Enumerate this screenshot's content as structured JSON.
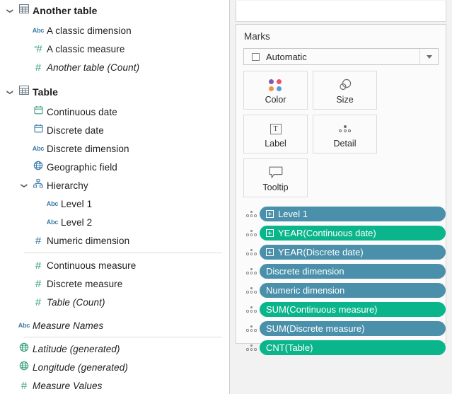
{
  "data_pane": {
    "groups": [
      {
        "name": "Another table",
        "icon": "table-icon",
        "expanded": true,
        "fields": [
          {
            "label": "A classic dimension",
            "icon": "abc-icon",
            "type": "dimension",
            "italic": false,
            "indent": 1
          },
          {
            "label": "A classic measure",
            "icon": "calculated-number-icon",
            "type": "measure",
            "italic": false,
            "indent": 1
          },
          {
            "label": "Another table (Count)",
            "icon": "number-icon",
            "type": "measure",
            "italic": true,
            "indent": 1
          }
        ]
      },
      {
        "name": "Table",
        "icon": "table-icon",
        "expanded": true,
        "fields": [
          {
            "label": "Continuous date",
            "icon": "calendar-green-icon",
            "type": "dimension",
            "italic": false,
            "indent": 1
          },
          {
            "label": "Discrete date",
            "icon": "calendar-blue-icon",
            "type": "dimension",
            "italic": false,
            "indent": 1
          },
          {
            "label": "Discrete dimension",
            "icon": "abc-icon",
            "type": "dimension",
            "italic": false,
            "indent": 1
          },
          {
            "label": "Geographic field",
            "icon": "globe-blue-icon",
            "type": "dimension",
            "italic": false,
            "indent": 1
          },
          {
            "label": "Hierarchy",
            "icon": "hierarchy-icon",
            "type": "hierarchy",
            "italic": false,
            "indent": 1,
            "expanded": true
          },
          {
            "label": "Level 1",
            "icon": "abc-icon",
            "type": "dimension",
            "italic": false,
            "indent": 2
          },
          {
            "label": "Level 2",
            "icon": "abc-icon",
            "type": "dimension",
            "italic": false,
            "indent": 2
          },
          {
            "label": "Numeric dimension",
            "icon": "number-blue-icon",
            "type": "dimension",
            "italic": false,
            "indent": 1
          },
          {
            "label": "Continuous measure",
            "icon": "number-icon",
            "type": "measure",
            "italic": false,
            "indent": 1,
            "divider_before": true
          },
          {
            "label": "Discrete measure",
            "icon": "number-icon",
            "type": "measure",
            "italic": false,
            "indent": 1
          },
          {
            "label": "Table (Count)",
            "icon": "number-icon",
            "type": "measure",
            "italic": true,
            "indent": 1
          }
        ]
      }
    ],
    "extra_fields": [
      {
        "label": "Measure Names",
        "icon": "abc-icon",
        "italic": true,
        "indent": 0
      },
      {
        "label": "Latitude (generated)",
        "icon": "globe-green-icon",
        "italic": true,
        "indent": 0,
        "divider_before": true
      },
      {
        "label": "Longitude (generated)",
        "icon": "globe-green-icon",
        "italic": true,
        "indent": 0
      },
      {
        "label": "Measure Values",
        "icon": "number-icon",
        "italic": true,
        "indent": 0
      }
    ]
  },
  "marks_card": {
    "title": "Marks",
    "mark_type": {
      "value": "Automatic",
      "icon": "square-outline-icon",
      "dropdown_icon": "chevron-down-icon"
    },
    "buttons": [
      {
        "label": "Color",
        "icon": "color-dots-icon"
      },
      {
        "label": "Size",
        "icon": "size-circles-icon"
      },
      {
        "label": "Label",
        "icon": "label-text-icon"
      },
      {
        "label": "Detail",
        "icon": "detail-dots-icon"
      },
      {
        "label": "Tooltip",
        "icon": "tooltip-bubble-icon"
      }
    ],
    "color_dots": [
      "#7b5ea7",
      "#e8566b",
      "#f0924a",
      "#5b9bd5"
    ],
    "pills": [
      {
        "label": "Level 1",
        "kind": "discrete",
        "expandable": true
      },
      {
        "label": "YEAR(Continuous date)",
        "kind": "continuous",
        "expandable": true
      },
      {
        "label": "YEAR(Discrete date)",
        "kind": "discrete",
        "expandable": true
      },
      {
        "label": "Discrete dimension",
        "kind": "discrete",
        "expandable": false
      },
      {
        "label": "Numeric dimension",
        "kind": "discrete",
        "expandable": false
      },
      {
        "label": "SUM(Continuous measure)",
        "kind": "continuous",
        "expandable": false
      },
      {
        "label": "SUM(Discrete measure)",
        "kind": "discrete",
        "expandable": false
      },
      {
        "label": "CNT(Table)",
        "kind": "continuous",
        "expandable": false
      }
    ]
  },
  "colors": {
    "discrete_pill": "#4a90ab",
    "continuous_pill": "#0ab58b",
    "dimension_icon": "#3b7ca8",
    "measure_icon": "#39a07e"
  }
}
